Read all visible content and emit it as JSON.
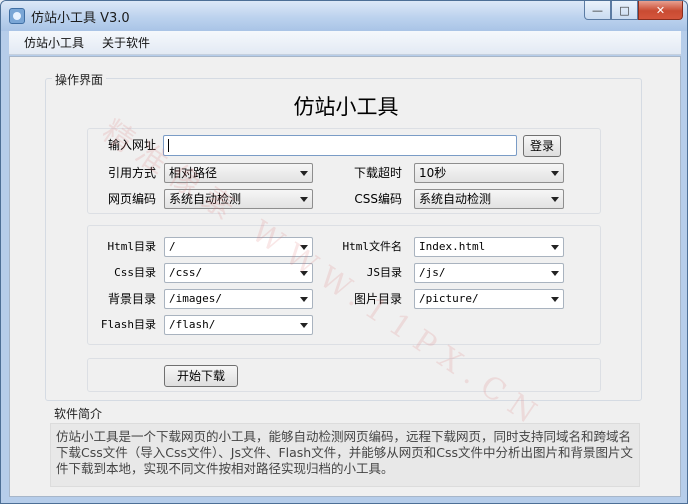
{
  "window": {
    "title": "仿站小工具 V3.0",
    "controls": {
      "minimize": "—",
      "maximize": "□",
      "close": "✕"
    }
  },
  "menu": [
    "仿站小工具",
    "关于软件"
  ],
  "operation": {
    "group_label": "操作界面",
    "heading": "仿站小工具",
    "url_label": "输入网址",
    "url_value": "",
    "login_button": "登录",
    "ref_mode_label": "引用方式",
    "ref_mode_value": "相对路径",
    "timeout_label": "下载超时",
    "timeout_value": "10秒",
    "page_encoding_label": "网页编码",
    "page_encoding_value": "系统自动检测",
    "css_encoding_label": "CSS编码",
    "css_encoding_value": "系统自动检测",
    "html_dir_label": "Html目录",
    "html_dir_value": "/",
    "html_file_label": "Html文件名",
    "html_file_value": "Index.html",
    "css_dir_label": "Css目录",
    "css_dir_value": "/css/",
    "js_dir_label": "JS目录",
    "js_dir_value": "/js/",
    "bg_dir_label": "背景目录",
    "bg_dir_value": "/images/",
    "pic_dir_label": "图片目录",
    "pic_dir_value": "/picture/",
    "flash_dir_label": "Flash目录",
    "flash_dir_value": "/flash/",
    "start_button": "开始下载"
  },
  "intro": {
    "group_label": "软件简介",
    "text": "仿站小工具是一个下载网页的小工具，能够自动检测网页编码，远程下载网页，同时支持同域名和跨域名下载Css文件（导入Css文件）、Js文件、Flash文件，并能够从网页和Css文件中分析出图片和背景图片文件下载到本地，实现不同文件按相对路径实现归档的小工具。"
  },
  "watermark": "精准像素 WWW.11PX.CN",
  "colors": {
    "title_bar": "#bcd2ee",
    "client_bg": "#f0f0f0",
    "close_button": "#c94b32"
  }
}
